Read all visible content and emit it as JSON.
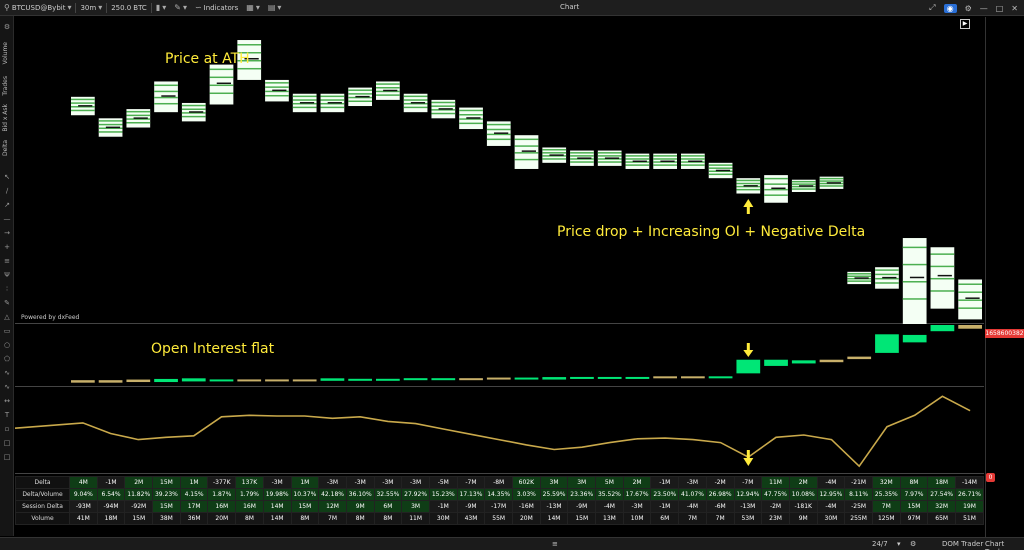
{
  "toolbar": {
    "symbol": "BTCUSD@Bybit",
    "interval": "30m",
    "size": "250.0",
    "size_unit": "BTC",
    "indicators_label": "Indicators",
    "title": "Chart"
  },
  "left_panel": {
    "labels": [
      "Volume",
      "Trades",
      "Bid x Ask",
      "Delta"
    ]
  },
  "annotations": {
    "ath": "Price at ATH",
    "drop": "Price drop + Increasing OI + Negative Delta",
    "oi_flat": "Open Interest flat"
  },
  "powered_by": "Powered by dxFeed",
  "oi_axis_value": "1658600382",
  "table_badge": "0",
  "colors": {
    "annotation": "#ffeb3b",
    "line": "#c9a94b",
    "oi_green": "#00e676",
    "oi_tan": "#c8b06a",
    "candle_up": "#ffffff",
    "candle_edge_red": "#e53935",
    "cell_green": "#1f8a2e",
    "cell_tan": "#a89a5a",
    "cell_dark": "#1a1a1a"
  },
  "icons": [
    "arrow-down-icon",
    "arrow-up-icon",
    "maximize-icon",
    "camera-icon",
    "gear-icon"
  ],
  "table": {
    "rows": [
      {
        "label": "Delta",
        "values": [
          "4M",
          "-1M",
          "2M",
          "15M",
          "1M",
          "-377K",
          "137K",
          "-3M",
          "1M",
          "-3M",
          "-3M",
          "-3M",
          "-3M",
          "-5M",
          "-7M",
          "-8M",
          "602K",
          "3M",
          "3M",
          "5M",
          "2M",
          "-1M",
          "-3M",
          "-2M",
          "-7M",
          "11M",
          "2M",
          "-4M",
          "-21M",
          "32M",
          "8M",
          "18M",
          "-14M"
        ]
      },
      {
        "label": "Delta/Volume",
        "values": [
          "9.04%",
          "6.54%",
          "11.82%",
          "39.23%",
          "4.15%",
          "1.87%",
          "1.79%",
          "19.98%",
          "10.37%",
          "42.18%",
          "36.10%",
          "32.55%",
          "27.92%",
          "15.23%",
          "17.13%",
          "14.35%",
          "3.03%",
          "25.59%",
          "23.36%",
          "35.52%",
          "17.67%",
          "23.50%",
          "41.07%",
          "26.98%",
          "12.94%",
          "47.75%",
          "10.08%",
          "12.95%",
          "8.11%",
          "25.35%",
          "7.97%",
          "27.54%",
          "26.71%"
        ]
      },
      {
        "label": "Session Delta",
        "values": [
          "-93M",
          "-94M",
          "-92M",
          "15M",
          "17M",
          "16M",
          "16M",
          "14M",
          "15M",
          "12M",
          "9M",
          "6M",
          "3M",
          "-1M",
          "-9M",
          "-17M",
          "-16M",
          "-13M",
          "-9M",
          "-4M",
          "-3M",
          "-1M",
          "-4M",
          "-6M",
          "-13M",
          "-2M",
          "-181K",
          "-4M",
          "-25M",
          "7M",
          "15M",
          "32M",
          "19M"
        ]
      },
      {
        "label": "Volume",
        "values": [
          "41M",
          "18M",
          "15M",
          "38M",
          "36M",
          "20M",
          "8M",
          "14M",
          "8M",
          "7M",
          "8M",
          "8M",
          "11M",
          "30M",
          "43M",
          "55M",
          "20M",
          "14M",
          "15M",
          "13M",
          "10M",
          "6M",
          "7M",
          "7M",
          "53M",
          "23M",
          "9M",
          "30M",
          "255M",
          "125M",
          "97M",
          "65M",
          "51M"
        ]
      }
    ]
  },
  "status": {
    "session": "24/7",
    "dom_trader": "DOM Trader",
    "chart_trader": "Chart Trader"
  },
  "chart_data": {
    "type": "line",
    "series": [
      {
        "values": [
          0.62,
          0.48,
          0.4,
          0.43,
          0.45,
          0.7,
          0.72,
          0.71,
          0.71,
          0.68,
          0.7,
          0.64,
          0.61,
          0.54,
          0.47,
          0.4,
          0.33,
          0.27,
          0.3,
          0.36,
          0.41,
          0.42,
          0.4,
          0.36,
          0.17,
          0.43,
          0.46,
          0.4,
          0.05,
          0.57,
          0.72,
          0.97,
          0.78
        ]
      }
    ]
  }
}
